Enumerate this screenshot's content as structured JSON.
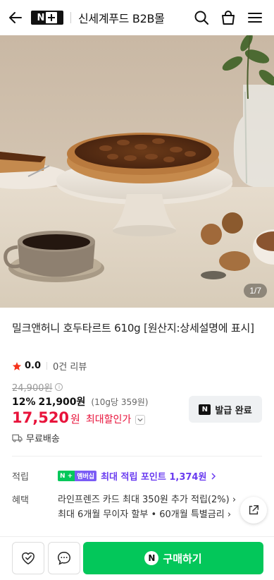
{
  "header": {
    "store_name": "신세계푸드 B2B몰",
    "logo_text": "N"
  },
  "gallery": {
    "counter": "1/7"
  },
  "product": {
    "title": "밀크앤허니 호두타르트 610g [원산지:상세설명에 표시]",
    "rating": "0.0",
    "reviews": "0건 리뷰",
    "original_price": "24,900원",
    "discount_percent": "12%",
    "discounted_price": "21,900원",
    "unit_price": "(10g당 359원)",
    "final_price": "17,520",
    "final_currency": "원",
    "final_label": "최대할인가",
    "coupon_label": "발급 완료",
    "shipping": "무료배송"
  },
  "benefits": {
    "points_label": "적립",
    "membership_badge": "멤버십",
    "points_text": "최대 적립 포인트 1,374원",
    "benefit_label": "혜택",
    "benefit_line1": "라인프렌즈 카드 최대 350원 추가 적립(2%)",
    "benefit_line2": "최대 6개월 무이자 할부 • 60개월 특별금리"
  },
  "bottom_bar": {
    "buy_label": "구매하기"
  },
  "colors": {
    "accent_green": "#03c75a",
    "price_red": "#e8133b",
    "points_purple": "#6a3cf0"
  }
}
